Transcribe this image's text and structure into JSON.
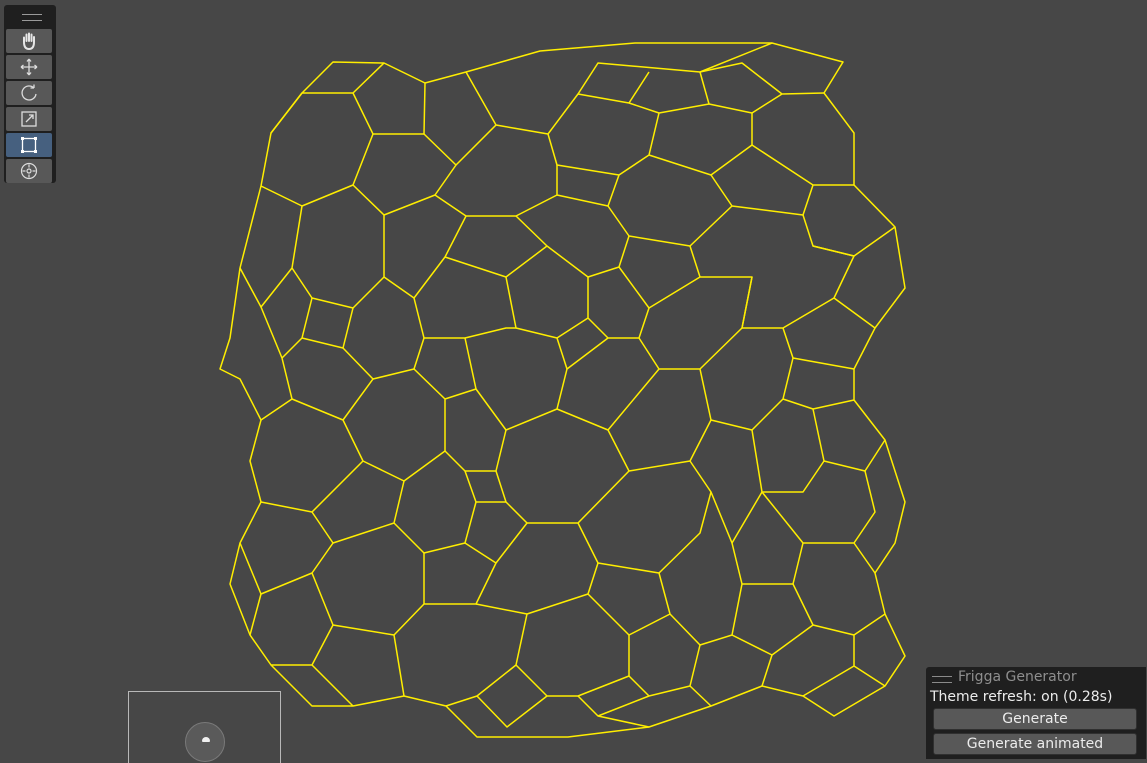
{
  "toolbar": {
    "tools": [
      {
        "icon": "hand-icon",
        "label": "View"
      },
      {
        "icon": "move-icon",
        "label": "Move"
      },
      {
        "icon": "rotate-icon",
        "label": "Rotate"
      },
      {
        "icon": "scale-icon",
        "label": "Scale"
      },
      {
        "icon": "rect-icon",
        "label": "Rect",
        "active": true
      },
      {
        "icon": "transform-icon",
        "label": "Transform"
      }
    ]
  },
  "colors": {
    "background": "#474747",
    "edges": "#ffee00",
    "panel": "#1f1f1f",
    "active_tool": "#46607f"
  },
  "panel": {
    "title": "Frigga Generator",
    "theme_status": "Theme refresh: on (0.28s)",
    "generate_label": "Generate",
    "generate_animated_label": "Generate animated"
  }
}
